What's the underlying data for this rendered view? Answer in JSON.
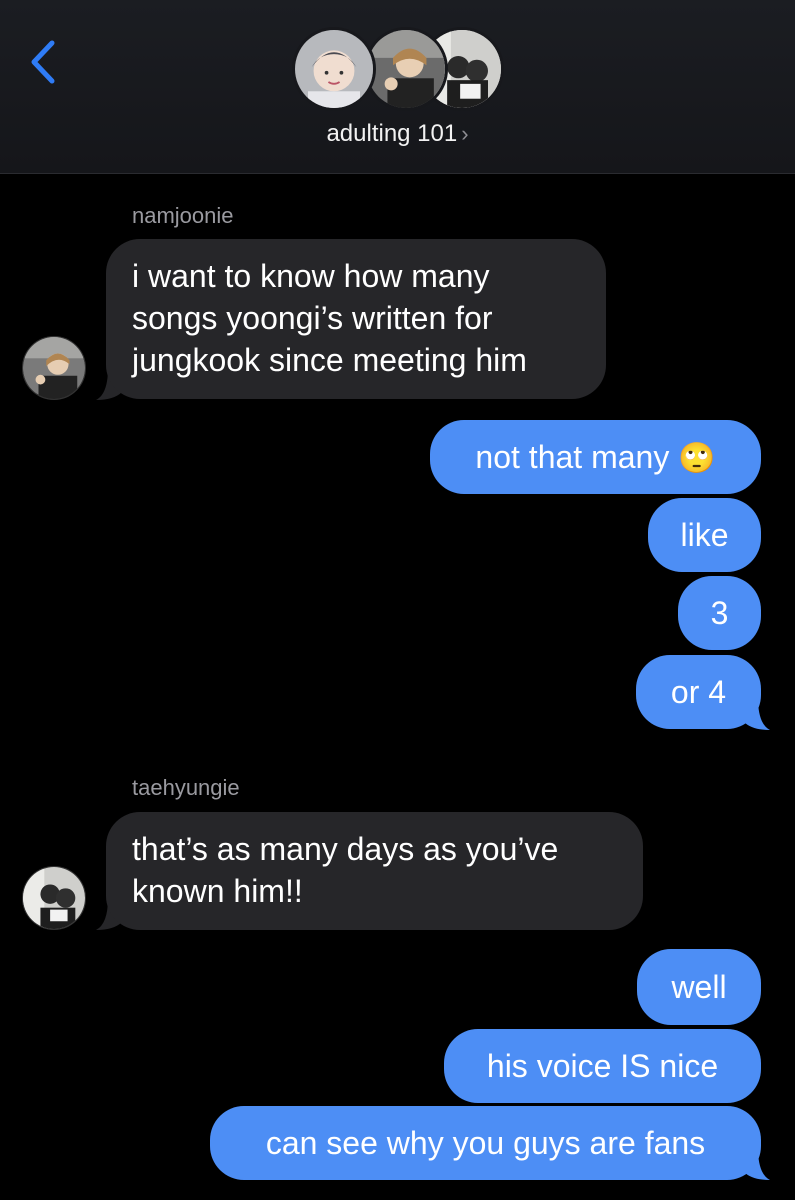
{
  "header": {
    "group_name": "adulting 101",
    "chevron": "›",
    "back_icon": "chevron-left-icon",
    "accent": "#2f7cf6"
  },
  "messages": {
    "sender_1": "namjoonie",
    "m1_l1": "i want to know how many",
    "m1_l2": "songs yoongi’s written for",
    "m1_l3": "jungkook since meeting him",
    "m2_text": "not that many",
    "m2_emoji": "🙄",
    "m3": "like",
    "m4": "3",
    "m5": "or 4",
    "sender_2": "taehyungie",
    "m6_l1": "that’s as many days as you’ve",
    "m6_l2": "known him!!",
    "m7": "well",
    "m8": "his voice IS nice",
    "m9": "can see why you guys are fans"
  },
  "colors": {
    "outgoing_bubble": "#4d8ef5",
    "incoming_bubble": "#262629",
    "background": "#000000"
  }
}
